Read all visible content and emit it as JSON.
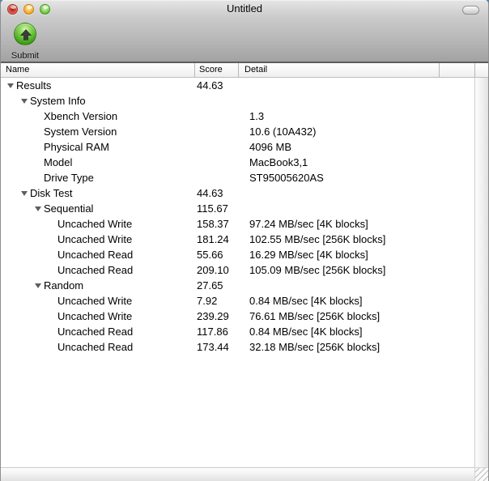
{
  "window": {
    "title": "Untitled"
  },
  "toolbar": {
    "submit_label": "Submit"
  },
  "table": {
    "columns": [
      {
        "label": "Name"
      },
      {
        "label": "Score"
      },
      {
        "label": "Detail"
      }
    ],
    "rows": [
      {
        "level": 0,
        "expandable": true,
        "name": "Results",
        "score": "44.63",
        "detail": ""
      },
      {
        "level": 1,
        "expandable": true,
        "name": "System Info",
        "score": "",
        "detail": ""
      },
      {
        "level": 2,
        "expandable": false,
        "name": "Xbench Version",
        "score": "",
        "detail": "1.3"
      },
      {
        "level": 2,
        "expandable": false,
        "name": "System Version",
        "score": "",
        "detail": "10.6 (10A432)"
      },
      {
        "level": 2,
        "expandable": false,
        "name": "Physical RAM",
        "score": "",
        "detail": "4096 MB"
      },
      {
        "level": 2,
        "expandable": false,
        "name": "Model",
        "score": "",
        "detail": "MacBook3,1"
      },
      {
        "level": 2,
        "expandable": false,
        "name": "Drive Type",
        "score": "",
        "detail": "ST95005620AS"
      },
      {
        "level": 1,
        "expandable": true,
        "name": "Disk Test",
        "score": "44.63",
        "detail": ""
      },
      {
        "level": 2,
        "expandable": true,
        "name": "Sequential",
        "score": "115.67",
        "detail": ""
      },
      {
        "level": 3,
        "expandable": false,
        "name": "Uncached Write",
        "score": "158.37",
        "detail": "97.24 MB/sec [4K blocks]"
      },
      {
        "level": 3,
        "expandable": false,
        "name": "Uncached Write",
        "score": "181.24",
        "detail": "102.55 MB/sec [256K blocks]"
      },
      {
        "level": 3,
        "expandable": false,
        "name": "Uncached Read",
        "score": "55.66",
        "detail": "16.29 MB/sec [4K blocks]"
      },
      {
        "level": 3,
        "expandable": false,
        "name": "Uncached Read",
        "score": "209.10",
        "detail": "105.09 MB/sec [256K blocks]"
      },
      {
        "level": 2,
        "expandable": true,
        "name": "Random",
        "score": "27.65",
        "detail": ""
      },
      {
        "level": 3,
        "expandable": false,
        "name": "Uncached Write",
        "score": "7.92",
        "detail": "0.84 MB/sec [4K blocks]"
      },
      {
        "level": 3,
        "expandable": false,
        "name": "Uncached Write",
        "score": "239.29",
        "detail": "76.61 MB/sec [256K blocks]"
      },
      {
        "level": 3,
        "expandable": false,
        "name": "Uncached Read",
        "score": "117.86",
        "detail": "0.84 MB/sec [4K blocks]"
      },
      {
        "level": 3,
        "expandable": false,
        "name": "Uncached Read",
        "score": "173.44",
        "detail": "32.18 MB/sec [256K blocks]"
      }
    ]
  },
  "icons": {
    "submit": "green-orb-up-arrow-icon",
    "disclosure": "down-triangle-icon",
    "resize": "diagonal-grip-icon",
    "close": "red-traffic-light",
    "minimize": "yellow-traffic-light",
    "zoom": "green-traffic-light"
  },
  "colors": {
    "submit_green": "#57b52a",
    "close_red": "#ee6a5e",
    "minimize_yellow": "#f7b338",
    "zoom_green": "#7ed04e",
    "toolbar_border": "#5d5d5d",
    "header_border": "#bdbdbd"
  }
}
